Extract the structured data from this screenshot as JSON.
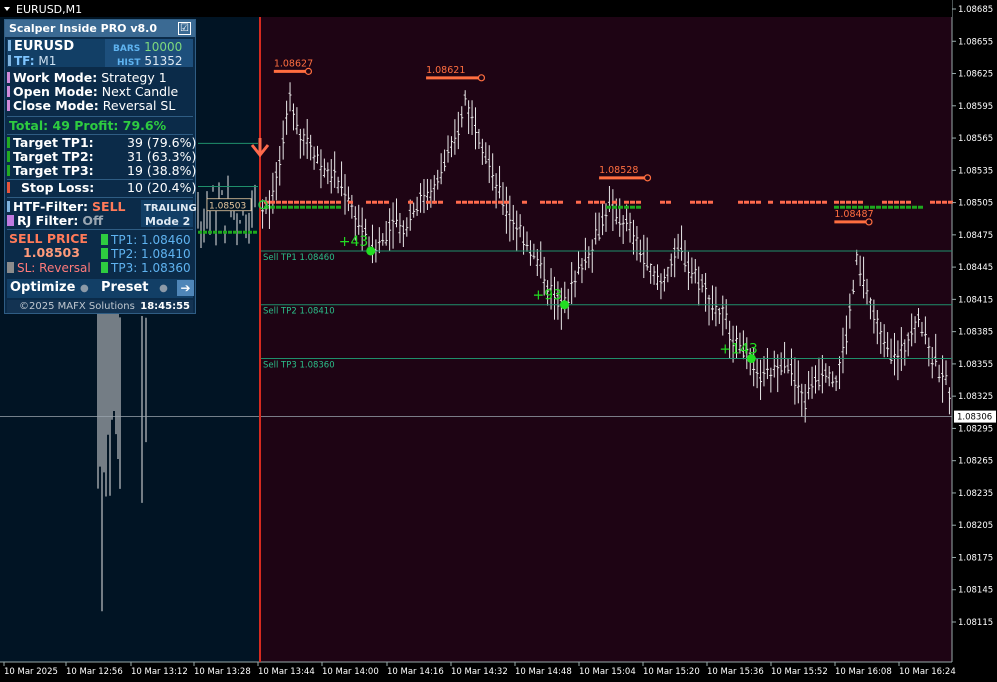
{
  "window_title": "EURUSD,M1",
  "panel": {
    "title": "Scalper Inside PRO v8.0",
    "checkbox": "☑",
    "symbol": "EURUSD",
    "tf_label": "TF:",
    "tf_value": "M1",
    "bars_label": "BARS",
    "bars_value": "10000",
    "hist_label": "HIST",
    "hist_value": "51352",
    "work_mode_label": "Work  Mode:",
    "work_mode_value": "Strategy 1",
    "open_mode_label": "Open  Mode:",
    "open_mode_value": "Next Candle",
    "close_mode_label": "Close Mode:",
    "close_mode_value": "Reversal SL",
    "total_label": "Total: 49",
    "profit_label": "Profit: 79.6%",
    "tp1_label": "Target TP1:",
    "tp1_value": "39 (79.6%)",
    "tp2_label": "Target TP2:",
    "tp2_value": "31 (63.3%)",
    "tp3_label": "Target TP3:",
    "tp3_value": "19 (38.8%)",
    "sl_label": "Stop Loss:",
    "sl_value": "10 (20.4%)",
    "htf_label": "HTF-Filter:",
    "htf_value": "SELL",
    "trailing_label": "TRAILING",
    "rj_label": "RJ Filter:",
    "rj_value": "Off",
    "mode_label": "Mode 2",
    "sell_price_label": "SELL PRICE",
    "sell_price_value": "1.08503",
    "sl_reversal": "SL: Reversal",
    "tp1_price": "TP1: 1.08460",
    "tp2_price": "TP2: 1.08410",
    "tp3_price": "TP3: 1.08360",
    "optimize": "Optimize",
    "preset": "Preset",
    "arrow": "➔",
    "copyright": "©2025 MAFX Solutions",
    "clock": "18:45:55"
  },
  "colors": {
    "chart_bg_left": "#011424",
    "chart_bg_right": "#1e0414",
    "tp_line": "#1f8f6b",
    "signal_line": "#d62a1f",
    "sell_bar": "#ff6a4d",
    "buy_bar": "#1ea81e",
    "level_label": "#ff6e40",
    "profit_green": "#22dd22"
  },
  "chart_data": {
    "type": "ohlc",
    "symbol": "EURUSD",
    "timeframe": "M1",
    "ylim": [
      1.081,
      1.0869
    ],
    "y_ticks": [
      "1.08685",
      "1.08655",
      "1.08625",
      "1.08595",
      "1.08565",
      "1.08535",
      "1.08505",
      "1.08475",
      "1.08445",
      "1.08415",
      "1.08385",
      "1.08355",
      "1.08325",
      "1.08295",
      "1.08265",
      "1.08235",
      "1.08205",
      "1.08175",
      "1.08145",
      "1.08115"
    ],
    "x_ticks": [
      "10 Mar 2025",
      "10 Mar 12:56",
      "10 Mar 13:12",
      "10 Mar 13:28",
      "10 Mar 13:44",
      "10 Mar 14:00",
      "10 Mar 14:16",
      "10 Mar 14:32",
      "10 Mar 14:48",
      "10 Mar 15:04",
      "10 Mar 15:20",
      "10 Mar 15:36",
      "10 Mar 15:52",
      "10 Mar 16:08",
      "10 Mar 16:24"
    ],
    "current_price": "1.08306",
    "signal": {
      "type": "SELL",
      "time": "10 Mar 13:44",
      "price": 1.08503,
      "label": "1.08503"
    },
    "take_profit_lines": [
      {
        "label": "Sell TP1 1.08460",
        "price": 1.0846
      },
      {
        "label": "Sell TP2 1.08410",
        "price": 1.0841
      },
      {
        "label": "Sell TP3 1.08360",
        "price": 1.0836
      }
    ],
    "level_labels": [
      {
        "label": "1.08627",
        "price": 1.08627,
        "x_frac": 0.02,
        "w_frac": 0.05
      },
      {
        "label": "1.08621",
        "price": 1.08621,
        "x_frac": 0.24,
        "w_frac": 0.08
      },
      {
        "label": "1.08528",
        "price": 1.08528,
        "x_frac": 0.49,
        "w_frac": 0.07
      },
      {
        "label": "1.08487",
        "price": 1.08487,
        "x_frac": 0.83,
        "w_frac": 0.05
      }
    ],
    "profit_labels": [
      {
        "label": "+43",
        "price": 1.0846,
        "x_frac": 0.16
      },
      {
        "label": "+93",
        "price": 1.0841,
        "x_frac": 0.44
      },
      {
        "label": "+143",
        "price": 1.0836,
        "x_frac": 0.71
      }
    ],
    "price_series": [
      1.08503,
      1.0854,
      1.086,
      1.0857,
      1.0856,
      1.0854,
      1.0853,
      1.0852,
      1.085,
      1.0848,
      1.0846,
      1.0847,
      1.0849,
      1.0848,
      1.085,
      1.0851,
      1.0852,
      1.0854,
      1.0856,
      1.086,
      1.0858,
      1.0855,
      1.0852,
      1.085,
      1.0848,
      1.0847,
      1.0845,
      1.0843,
      1.0841,
      1.0842,
      1.0844,
      1.0846,
      1.0848,
      1.085,
      1.0849,
      1.0848,
      1.0846,
      1.0844,
      1.0843,
      1.0845,
      1.0846,
      1.0844,
      1.0843,
      1.0841,
      1.084,
      1.0838,
      1.0837,
      1.0835,
      1.0834,
      1.0835,
      1.0836,
      1.0834,
      1.0832,
      1.0834,
      1.0835,
      1.0834,
      1.0838,
      1.0845,
      1.0842,
      1.0839,
      1.0837,
      1.0836,
      1.0838,
      1.084,
      1.0837,
      1.0835,
      1.0833
    ]
  }
}
